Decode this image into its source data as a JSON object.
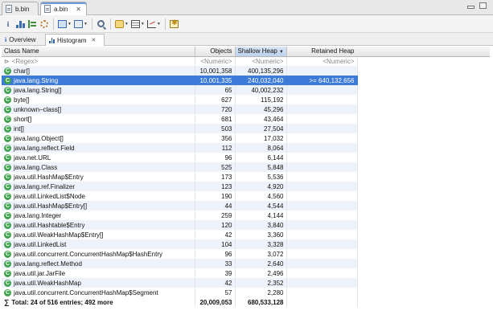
{
  "editor_tabs": [
    {
      "label": "b.bin",
      "active": false
    },
    {
      "label": "a.bin",
      "active": true
    }
  ],
  "editor_tab_close_glyph": "✕",
  "toolbar": {
    "icons": [
      "info-icon",
      "histogram-icon",
      "dominator-tree-icon",
      "gear-icon",
      "query-browser-icon",
      "run-report-icon",
      "search-icon",
      "heap-dump-icon",
      "table-icon",
      "chart-icon",
      "export-icon"
    ]
  },
  "view_tabs": [
    {
      "label": "Overview",
      "icon": "info-icon",
      "active": false
    },
    {
      "label": "Histogram",
      "icon": "histogram-icon",
      "active": true
    }
  ],
  "view_tab_close_glyph": "✕",
  "table": {
    "columns": [
      {
        "label": "Class Name"
      },
      {
        "label": "Objects"
      },
      {
        "label": "Shallow Heap",
        "sorted": true
      },
      {
        "label": "Retained Heap"
      }
    ],
    "filter_row": {
      "name": "<Regex>",
      "objects": "<Numeric>",
      "shallow": "<Numeric>",
      "retained": "<Numeric>"
    },
    "rows": [
      {
        "name": "char[]",
        "objects": "10,001,358",
        "shallow": "400,135,296",
        "retained": ""
      },
      {
        "name": "java.lang.String",
        "objects": "10,001,335",
        "shallow": "240,032,040",
        "retained": ">= 640,132,656",
        "selected": true
      },
      {
        "name": "java.lang.String[]",
        "objects": "65",
        "shallow": "40,002,232",
        "retained": ""
      },
      {
        "name": "byte[]",
        "objects": "627",
        "shallow": "115,192",
        "retained": ""
      },
      {
        "name": "unknown–class[]",
        "objects": "720",
        "shallow": "45,296",
        "retained": ""
      },
      {
        "name": "short[]",
        "objects": "681",
        "shallow": "43,464",
        "retained": ""
      },
      {
        "name": "int[]",
        "objects": "503",
        "shallow": "27,504",
        "retained": ""
      },
      {
        "name": "java.lang.Object[]",
        "objects": "356",
        "shallow": "17,032",
        "retained": ""
      },
      {
        "name": "java.lang.reflect.Field",
        "objects": "112",
        "shallow": "8,064",
        "retained": ""
      },
      {
        "name": "java.net.URL",
        "objects": "96",
        "shallow": "6,144",
        "retained": ""
      },
      {
        "name": "java.lang.Class",
        "objects": "525",
        "shallow": "5,848",
        "retained": ""
      },
      {
        "name": "java.util.HashMap$Entry",
        "objects": "173",
        "shallow": "5,536",
        "retained": ""
      },
      {
        "name": "java.lang.ref.Finalizer",
        "objects": "123",
        "shallow": "4,920",
        "retained": ""
      },
      {
        "name": "java.util.LinkedList$Node",
        "objects": "190",
        "shallow": "4,560",
        "retained": ""
      },
      {
        "name": "java.util.HashMap$Entry[]",
        "objects": "44",
        "shallow": "4,544",
        "retained": ""
      },
      {
        "name": "java.lang.Integer",
        "objects": "259",
        "shallow": "4,144",
        "retained": ""
      },
      {
        "name": "java.util.Hashtable$Entry",
        "objects": "120",
        "shallow": "3,840",
        "retained": ""
      },
      {
        "name": "java.util.WeakHashMap$Entry[]",
        "objects": "42",
        "shallow": "3,360",
        "retained": ""
      },
      {
        "name": "java.util.LinkedList",
        "objects": "104",
        "shallow": "3,328",
        "retained": ""
      },
      {
        "name": "java.util.concurrent.ConcurrentHashMap$HashEntry",
        "objects": "96",
        "shallow": "3,072",
        "retained": ""
      },
      {
        "name": "java.lang.reflect.Method",
        "objects": "33",
        "shallow": "2,640",
        "retained": ""
      },
      {
        "name": "java.util.jar.JarFile",
        "objects": "39",
        "shallow": "2,496",
        "retained": ""
      },
      {
        "name": "java.util.WeakHashMap",
        "objects": "42",
        "shallow": "2,352",
        "retained": ""
      },
      {
        "name": "java.util.concurrent.ConcurrentHashMap$Segment",
        "objects": "57",
        "shallow": "2,280",
        "retained": ""
      }
    ],
    "total_row": {
      "name": "Total: 24 of 516 entries; 492 more",
      "objects": "20,009,053",
      "shallow": "680,533,128",
      "retained": ""
    }
  }
}
